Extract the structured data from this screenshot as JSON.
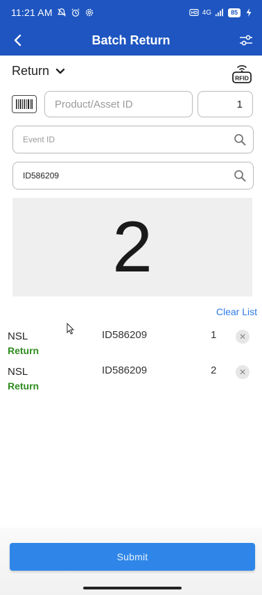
{
  "status_bar": {
    "time": "11:21 AM",
    "network": "4G",
    "battery": "85",
    "icons": [
      "mute-icon",
      "alarm-icon",
      "settings-icon",
      "signal-icon",
      "battery-icon"
    ]
  },
  "app_bar": {
    "title": "Batch Return",
    "back_icon": "chevron-left-icon",
    "filter_icon": "sliders-icon",
    "background": "#1e55c0"
  },
  "mode": {
    "label": "Return",
    "icon": "chevron-down-icon"
  },
  "rfid": {
    "label": "RFID",
    "icon": "rfid-icon"
  },
  "scan": {
    "product_placeholder": "Product/Asset ID",
    "quantity_value": "1",
    "event_placeholder": "Event ID",
    "id_value": "ID586209"
  },
  "counter": {
    "value": "2"
  },
  "list": {
    "clear_label": "Clear List",
    "items": [
      {
        "name": "NSL",
        "type": "Return",
        "asset_id": "ID586209",
        "qty": "1"
      },
      {
        "name": "NSL",
        "type": "Return",
        "asset_id": "ID586209",
        "qty": "2"
      }
    ],
    "type_color": "#2e8b1e",
    "remove_icon": "close-icon"
  },
  "footer": {
    "submit_label": "Submit",
    "accent": "#2f86e8"
  }
}
